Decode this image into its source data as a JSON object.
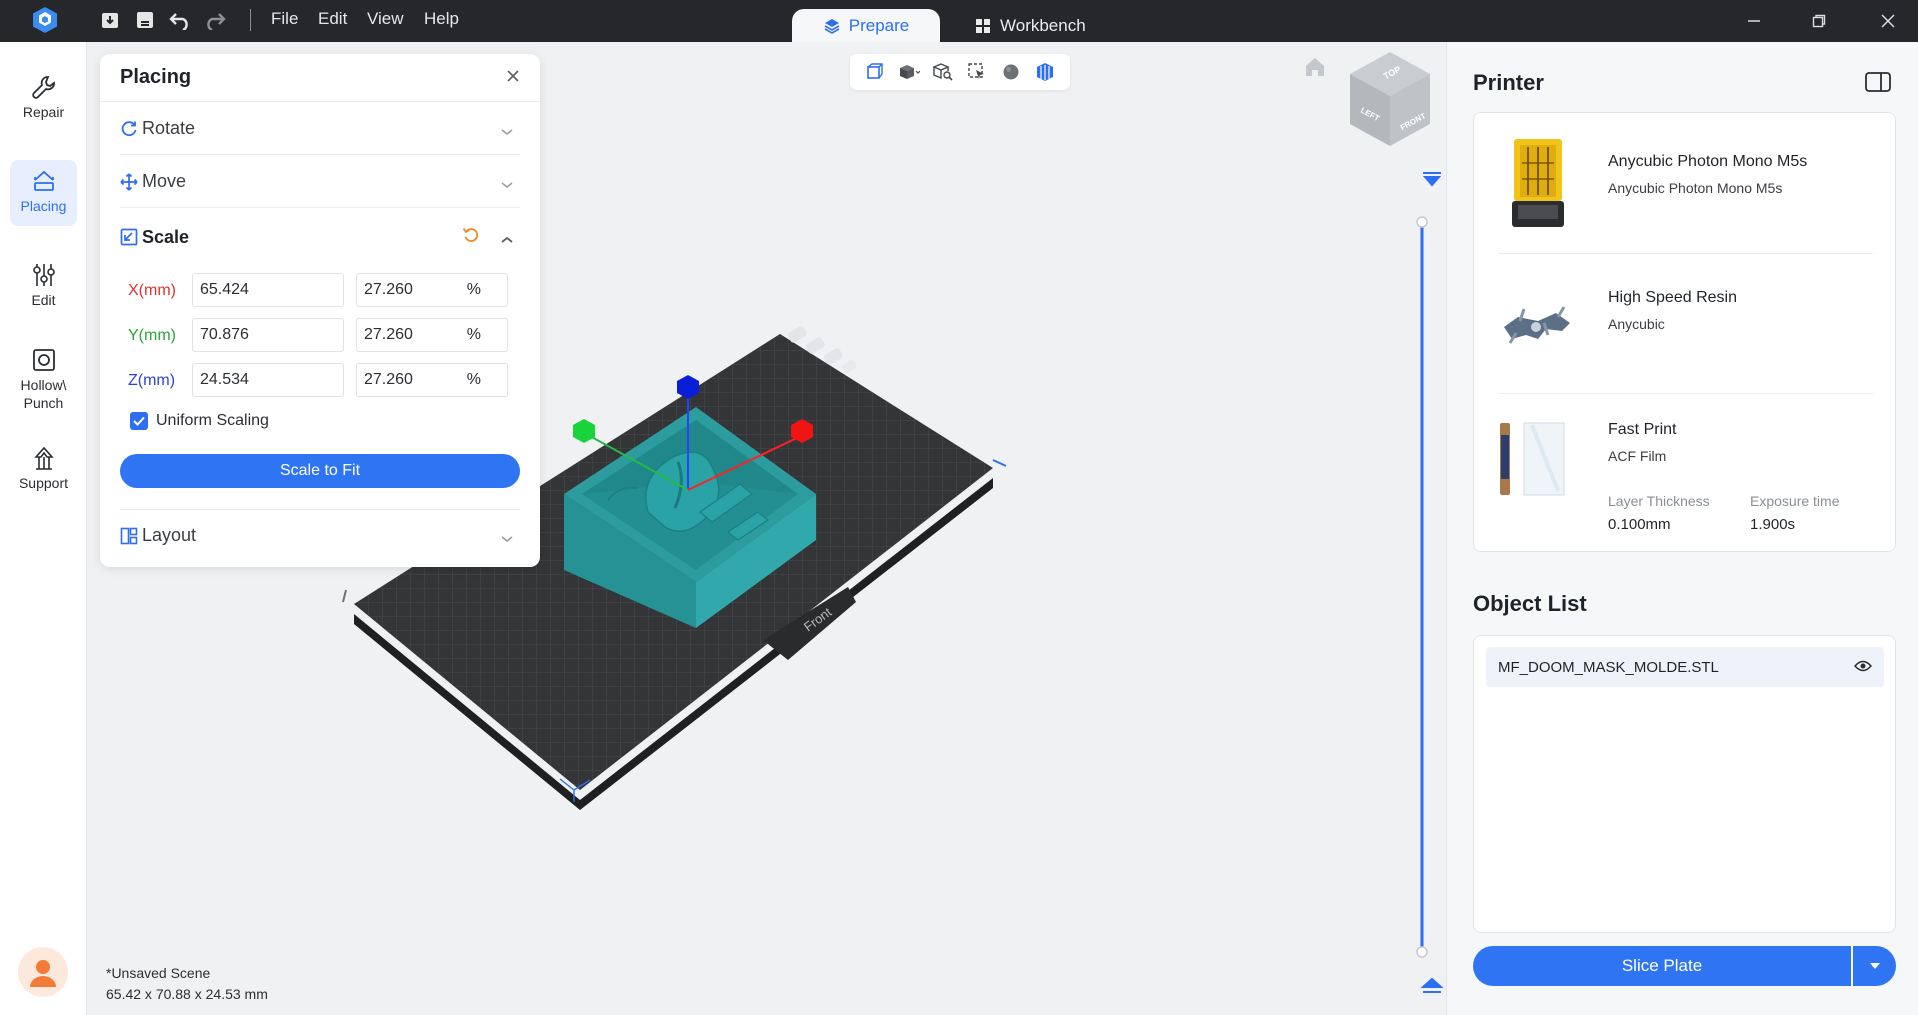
{
  "titlebar": {
    "menu": [
      "File",
      "Edit",
      "View",
      "Help"
    ],
    "tabs": {
      "prepare": "Prepare",
      "workbench": "Workbench"
    }
  },
  "rail": {
    "items": [
      {
        "label": "Repair",
        "icon": "wrench-icon"
      },
      {
        "label": "Placing",
        "icon": "placing-icon"
      },
      {
        "label": "Edit",
        "icon": "sliders-icon"
      },
      {
        "label": "Hollow\\\nPunch",
        "icon": "hollow-icon"
      },
      {
        "label": "Support",
        "icon": "support-icon"
      }
    ]
  },
  "placing": {
    "title": "Placing",
    "rotate": "Rotate",
    "move": "Move",
    "scale": "Scale",
    "layout": "Layout",
    "x_label": "X(mm)",
    "x_value": "65.424",
    "x_pct": "27.260",
    "y_label": "Y(mm)",
    "y_value": "70.876",
    "y_pct": "27.260",
    "z_label": "Z(mm)",
    "z_value": "24.534",
    "z_pct": "27.260",
    "pct_symbol": "%",
    "uniform": "Uniform Scaling",
    "scale_to_fit": "Scale to Fit"
  },
  "viewport": {
    "front_label": "Front",
    "cube_top": "TOP",
    "cube_left": "LEFT",
    "cube_front": "FRONT",
    "scene_name": "*Unsaved Scene",
    "scene_dims": "65.42 x 70.88 x 24.53 mm"
  },
  "printer": {
    "title": "Printer",
    "machine_name": "Anycubic Photon Mono M5s",
    "machine_sub": "Anycubic Photon Mono M5s",
    "resin_name": "High Speed Resin",
    "resin_sub": "Anycubic",
    "profile_name": "Fast Print",
    "profile_sub": "ACF Film",
    "layer_label": "Layer Thickness",
    "layer_value": "0.100mm",
    "exposure_label": "Exposure time",
    "exposure_value": "1.900s"
  },
  "objects": {
    "title": "Object List",
    "items": [
      "MF_DOOM_MASK_MOLDE.STL"
    ]
  },
  "slice": {
    "label": "Slice Plate"
  },
  "colors": {
    "accent": "#2f74f3",
    "model": "#2fa7a9",
    "plate": "#333537"
  }
}
